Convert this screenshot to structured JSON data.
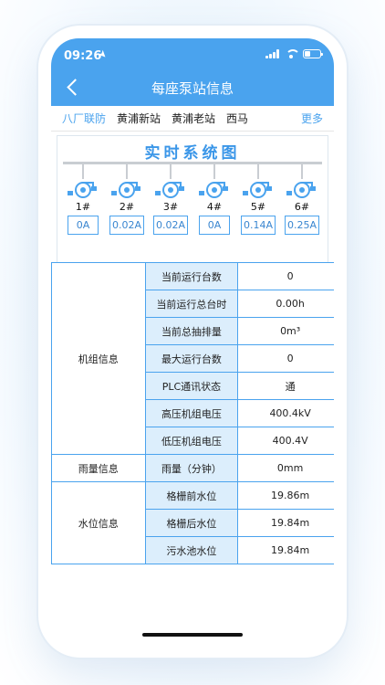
{
  "status": {
    "time": "09:26"
  },
  "nav": {
    "title": "每座泵站信息"
  },
  "tabs": [
    {
      "label": "八厂联防"
    },
    {
      "label": "黄浦新站"
    },
    {
      "label": "黄浦老站"
    },
    {
      "label": "西马"
    },
    {
      "label": "更多"
    }
  ],
  "diagram": {
    "title": "实时系统图",
    "pumps": [
      {
        "num": "1#",
        "current": "0A"
      },
      {
        "num": "2#",
        "current": "0.02A"
      },
      {
        "num": "3#",
        "current": "0.02A"
      },
      {
        "num": "4#",
        "current": "0A"
      },
      {
        "num": "5#",
        "current": "0.14A"
      },
      {
        "num": "6#",
        "current": "0.25A"
      }
    ]
  },
  "table": {
    "unit_group": "机组信息",
    "unit_rows": [
      {
        "label": "当前运行台数",
        "value": "0"
      },
      {
        "label": "当前运行总台时",
        "value": "0.00h"
      },
      {
        "label": "当前总抽排量",
        "value": "0m³"
      },
      {
        "label": "最大运行台数",
        "value": "0"
      },
      {
        "label": "PLC通讯状态",
        "value": "通"
      },
      {
        "label": "高压机组电压",
        "value": "400.4kV"
      },
      {
        "label": "低压机组电压",
        "value": "400.4V"
      }
    ],
    "rain_group": "雨量信息",
    "rain_rows": [
      {
        "label": "雨量（分钟）",
        "value": "0mm"
      }
    ],
    "water_group": "水位信息",
    "water_rows": [
      {
        "label": "格栅前水位",
        "value": "19.86m"
      },
      {
        "label": "格栅后水位",
        "value": "19.84m"
      },
      {
        "label": "污水池水位",
        "value": "19.84m"
      }
    ]
  },
  "colors": {
    "accent": "#4aa3ee",
    "label_bg": "#dceefc"
  }
}
